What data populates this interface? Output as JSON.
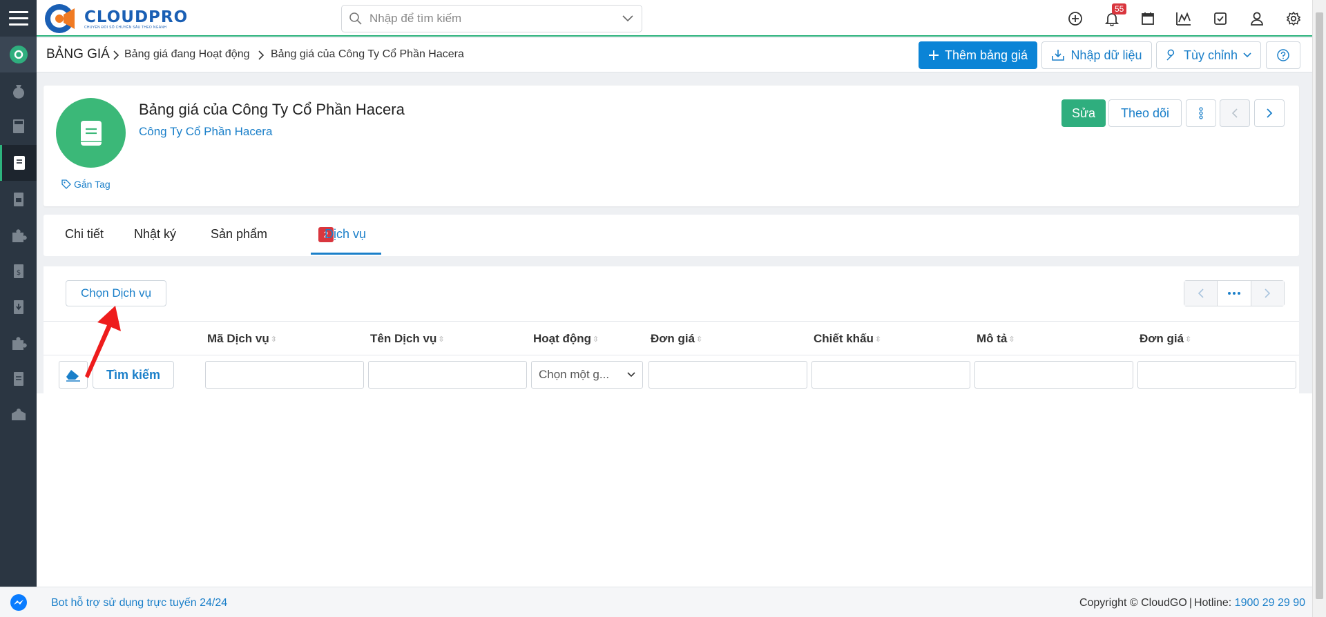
{
  "app": {
    "name": "CLOUDPRO",
    "tagline": "CHUYỂN ĐỔI SỐ CHUYÊN SÂU THEO NGÀNH",
    "brand_color": "#1a5fb4",
    "accent_color": "#2db37d"
  },
  "search": {
    "placeholder": "Nhập để tìm kiếm"
  },
  "top_icons": [
    "plus-circle-icon",
    "bell-icon",
    "calendar-icon",
    "chart-icon",
    "checkbox-icon",
    "user-icon",
    "gear-icon"
  ],
  "notifications": {
    "count": "55"
  },
  "breadcrumb": {
    "root": "BẢNG GIÁ",
    "items": [
      "Bảng giá đang Hoạt động",
      "Bảng giá của Công Ty Cổ Phần Hacera"
    ]
  },
  "actions": {
    "add_label": "Thêm bảng giá",
    "import_label": "Nhập dữ liệu",
    "customize_label": "Tùy chỉnh"
  },
  "record": {
    "title": "Bảng giá của Công Ty Cổ Phần Hacera",
    "subtitle": "Công Ty Cổ Phần Hacera",
    "tag_label": "Gắn Tag",
    "edit_label": "Sửa",
    "follow_label": "Theo dõi"
  },
  "tabs": [
    {
      "label": "Chi tiết"
    },
    {
      "label": "Nhật ký"
    },
    {
      "label": "Sản phẩm",
      "badge": "2"
    },
    {
      "label": "Dịch vụ",
      "active": true
    }
  ],
  "related": {
    "choose_label": "Chọn Dịch vụ",
    "search_label": "Tìm kiếm",
    "columns": [
      "Mã Dịch vụ",
      "Tên Dịch vụ",
      "Hoạt động",
      "Đơn giá",
      "Chiết khấu",
      "Mô tả",
      "Đơn giá"
    ],
    "active_select_placeholder": "Chọn một g..."
  },
  "footer": {
    "bot_text": "Bot hỗ trợ sử dụng trực tuyến 24/24",
    "copyright": "Copyright © CloudGO",
    "hotline_label": "Hotline:",
    "hotline_number": "1900 29 29 90"
  }
}
